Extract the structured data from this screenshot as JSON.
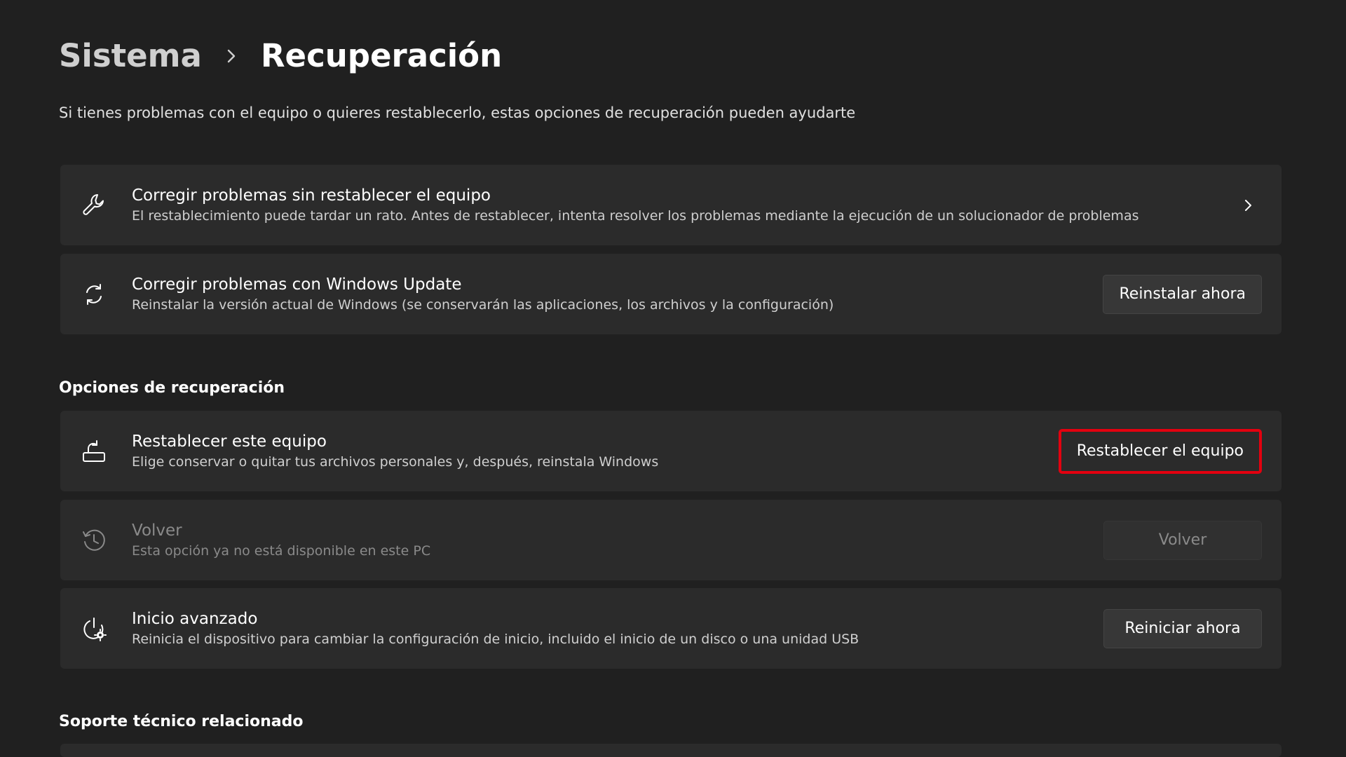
{
  "breadcrumb": {
    "parent": "Sistema",
    "current": "Recuperación"
  },
  "subtitle": "Si tienes problemas con el equipo o quieres restablecerlo, estas opciones de recuperación pueden ayudarte",
  "top_cards": [
    {
      "icon": "wrench-icon",
      "title": "Corregir problemas sin restablecer el equipo",
      "description": "El restablecimiento puede tardar un rato. Antes de restablecer, intenta resolver los problemas mediante la ejecución de un solucionador de problemas"
    },
    {
      "icon": "sync-icon",
      "title": "Corregir problemas con Windows Update",
      "description": "Reinstalar la versión actual de Windows (se conservarán las aplicaciones, los archivos y la configuración)",
      "button": "Reinstalar ahora"
    }
  ],
  "recovery_section": {
    "title": "Opciones de recuperación",
    "items": [
      {
        "icon": "reset-pc-icon",
        "title": "Restablecer este equipo",
        "description": "Elige conservar o quitar tus archivos personales y, después, reinstala Windows",
        "button": "Restablecer el equipo"
      },
      {
        "icon": "history-icon",
        "title": "Volver",
        "description": "Esta opción ya no está disponible en este PC",
        "button": "Volver",
        "disabled": true
      },
      {
        "icon": "advanced-startup-icon",
        "title": "Inicio avanzado",
        "description": "Reinicia el dispositivo para cambiar la configuración de inicio, incluido el inicio de un disco o una unidad USB",
        "button": "Reiniciar ahora"
      }
    ]
  },
  "support_section": {
    "title": "Soporte técnico relacionado"
  },
  "colors": {
    "background": "#202020",
    "card": "#2b2b2b",
    "button": "#373737",
    "highlight_border": "#e3000f",
    "disabled_text": "#8a8a8a"
  }
}
